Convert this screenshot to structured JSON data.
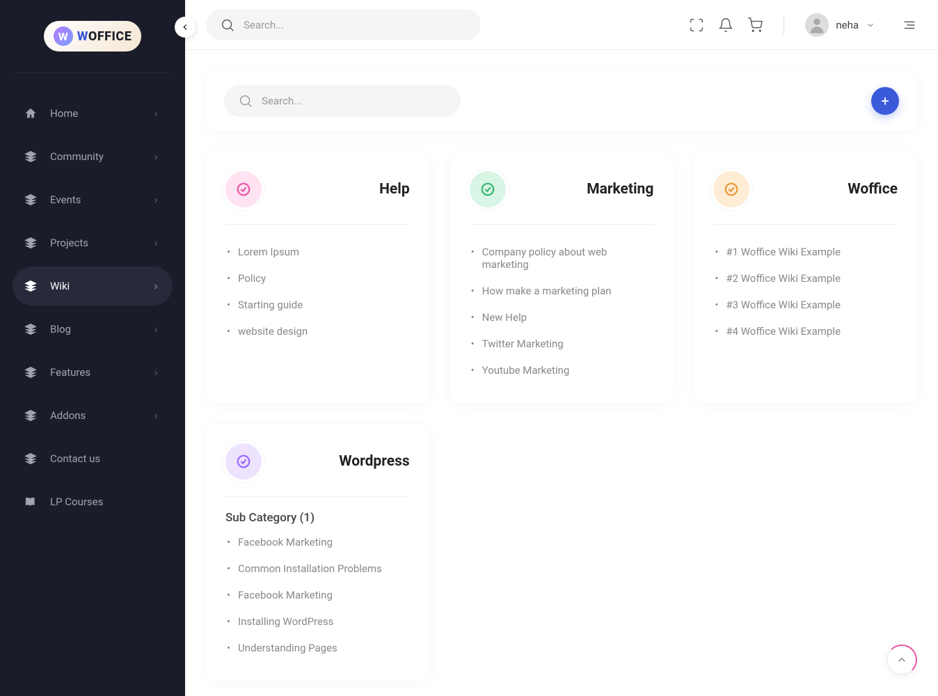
{
  "brand": {
    "name": "WOFFICE",
    "prefix": "W"
  },
  "sidebar": {
    "items": [
      {
        "label": "Home",
        "icon": "home-icon",
        "expandable": true
      },
      {
        "label": "Community",
        "icon": "stack-icon",
        "expandable": true
      },
      {
        "label": "Events",
        "icon": "stack-icon",
        "expandable": true
      },
      {
        "label": "Projects",
        "icon": "stack-icon",
        "expandable": true
      },
      {
        "label": "Wiki",
        "icon": "stack-icon",
        "expandable": true,
        "active": true
      },
      {
        "label": "Blog",
        "icon": "stack-icon",
        "expandable": true
      },
      {
        "label": "Features",
        "icon": "stack-icon",
        "expandable": true
      },
      {
        "label": "Addons",
        "icon": "stack-icon",
        "expandable": true
      },
      {
        "label": "Contact us",
        "icon": "stack-icon",
        "expandable": false
      },
      {
        "label": "LP Courses",
        "icon": "book-icon",
        "expandable": false
      }
    ]
  },
  "topbar": {
    "search_placeholder": "Search...",
    "user_name": "neha"
  },
  "section": {
    "search_placeholder": "Search...",
    "add_label": "+"
  },
  "cards": [
    {
      "title": "Help",
      "icon_class": "icon-pink",
      "icon_name": "check-circle-icon",
      "items": [
        "Lorem Ipsum",
        "Policy",
        "Starting guide",
        "website design"
      ]
    },
    {
      "title": "Marketing",
      "icon_class": "icon-green",
      "icon_name": "check-circle-icon",
      "items": [
        "Company policy about web marketing",
        "How make a marketing plan",
        "New Help",
        "Twitter Marketing",
        "Youtube Marketing"
      ]
    },
    {
      "title": "Woffice",
      "icon_class": "icon-orange",
      "icon_name": "check-circle-icon",
      "items": [
        "#1 Woffice Wiki Example",
        "#2 Woffice Wiki Example",
        "#3 Woffice Wiki Example",
        "#4 Woffice Wiki Example"
      ]
    },
    {
      "title": "Wordpress",
      "icon_class": "icon-purple",
      "icon_name": "check-circle-icon",
      "sub_category": "Sub Category (1)",
      "items": [
        "Facebook Marketing",
        "Common Installation Problems",
        "Facebook Marketing",
        "Installing WordPress",
        "Understanding Pages"
      ]
    }
  ]
}
